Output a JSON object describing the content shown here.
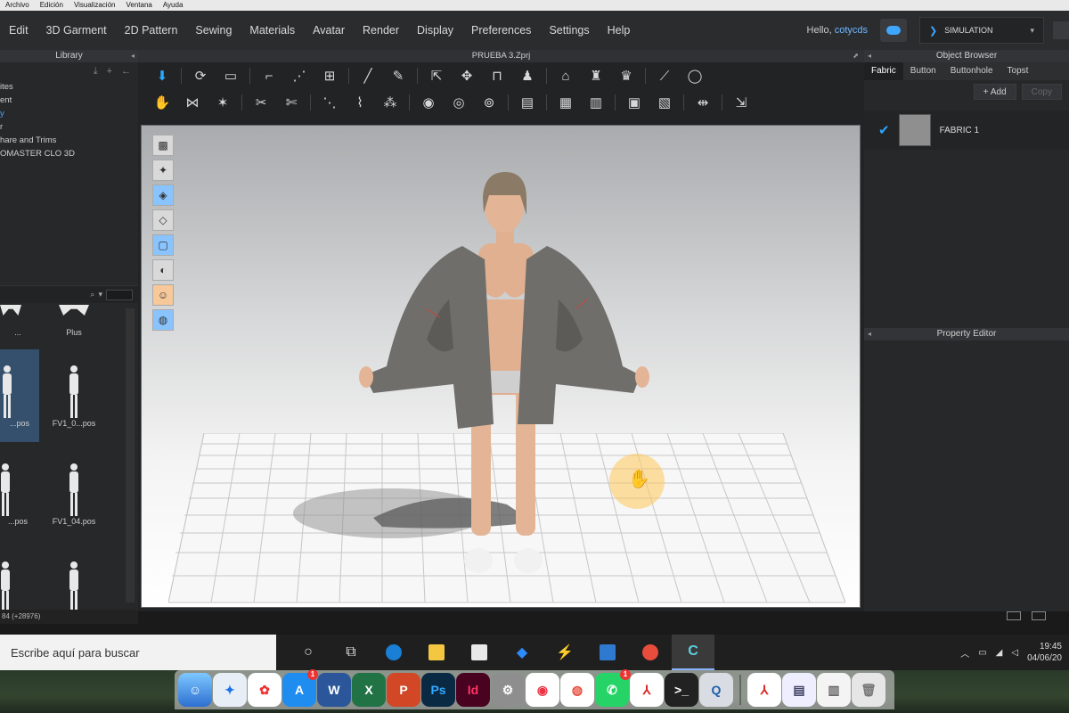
{
  "mac_menubar": {
    "items": [
      "Archivo",
      "Edición",
      "Visualización",
      "Ventana",
      "Ayuda"
    ]
  },
  "clo_menu": {
    "items": [
      "Edit",
      "3D Garment",
      "2D Pattern",
      "Sewing",
      "Materials",
      "Avatar",
      "Render",
      "Display",
      "Preferences",
      "Settings",
      "Help"
    ],
    "greeting": "Hello,",
    "username": "cotycds",
    "mode": "SIMULATION"
  },
  "library": {
    "title": "Library",
    "tree": [
      "ites",
      "ent",
      "y",
      "r",
      "",
      "hare and Trims",
      "",
      "",
      "OMASTER CLO 3D"
    ],
    "selected_index": 2,
    "grid": [
      {
        "label": "..."
      },
      {
        "label": "Plus"
      },
      {
        "label": "...pos"
      },
      {
        "label": "FV1_0...pos"
      },
      {
        "label": "...pos"
      },
      {
        "label": "FV1_04.pos"
      },
      {
        "label": ""
      },
      {
        "label": ""
      }
    ],
    "status": "84 (+28976)"
  },
  "document": {
    "title": "PRUEBA 3.Zprj"
  },
  "object_browser": {
    "title": "Object Browser",
    "tabs": [
      "Fabric",
      "Button",
      "Buttonhole",
      "Topst"
    ],
    "add_label": "+ Add",
    "copy_label": "Copy",
    "fabric_name": "FABRIC 1",
    "swatch_color": "#8f8f8f"
  },
  "property_editor": {
    "title": "Property Editor"
  },
  "taskbar": {
    "search_placeholder": "Escribe aquí para buscar",
    "time": "19:45",
    "date": "04/06/20"
  },
  "dock": {
    "badges": {
      "appstore": "1",
      "whatsapp": "1"
    }
  },
  "colors": {
    "accent": "#2aa8ff",
    "username": "#6fb8ff",
    "fabric": "#6f6e6b"
  }
}
